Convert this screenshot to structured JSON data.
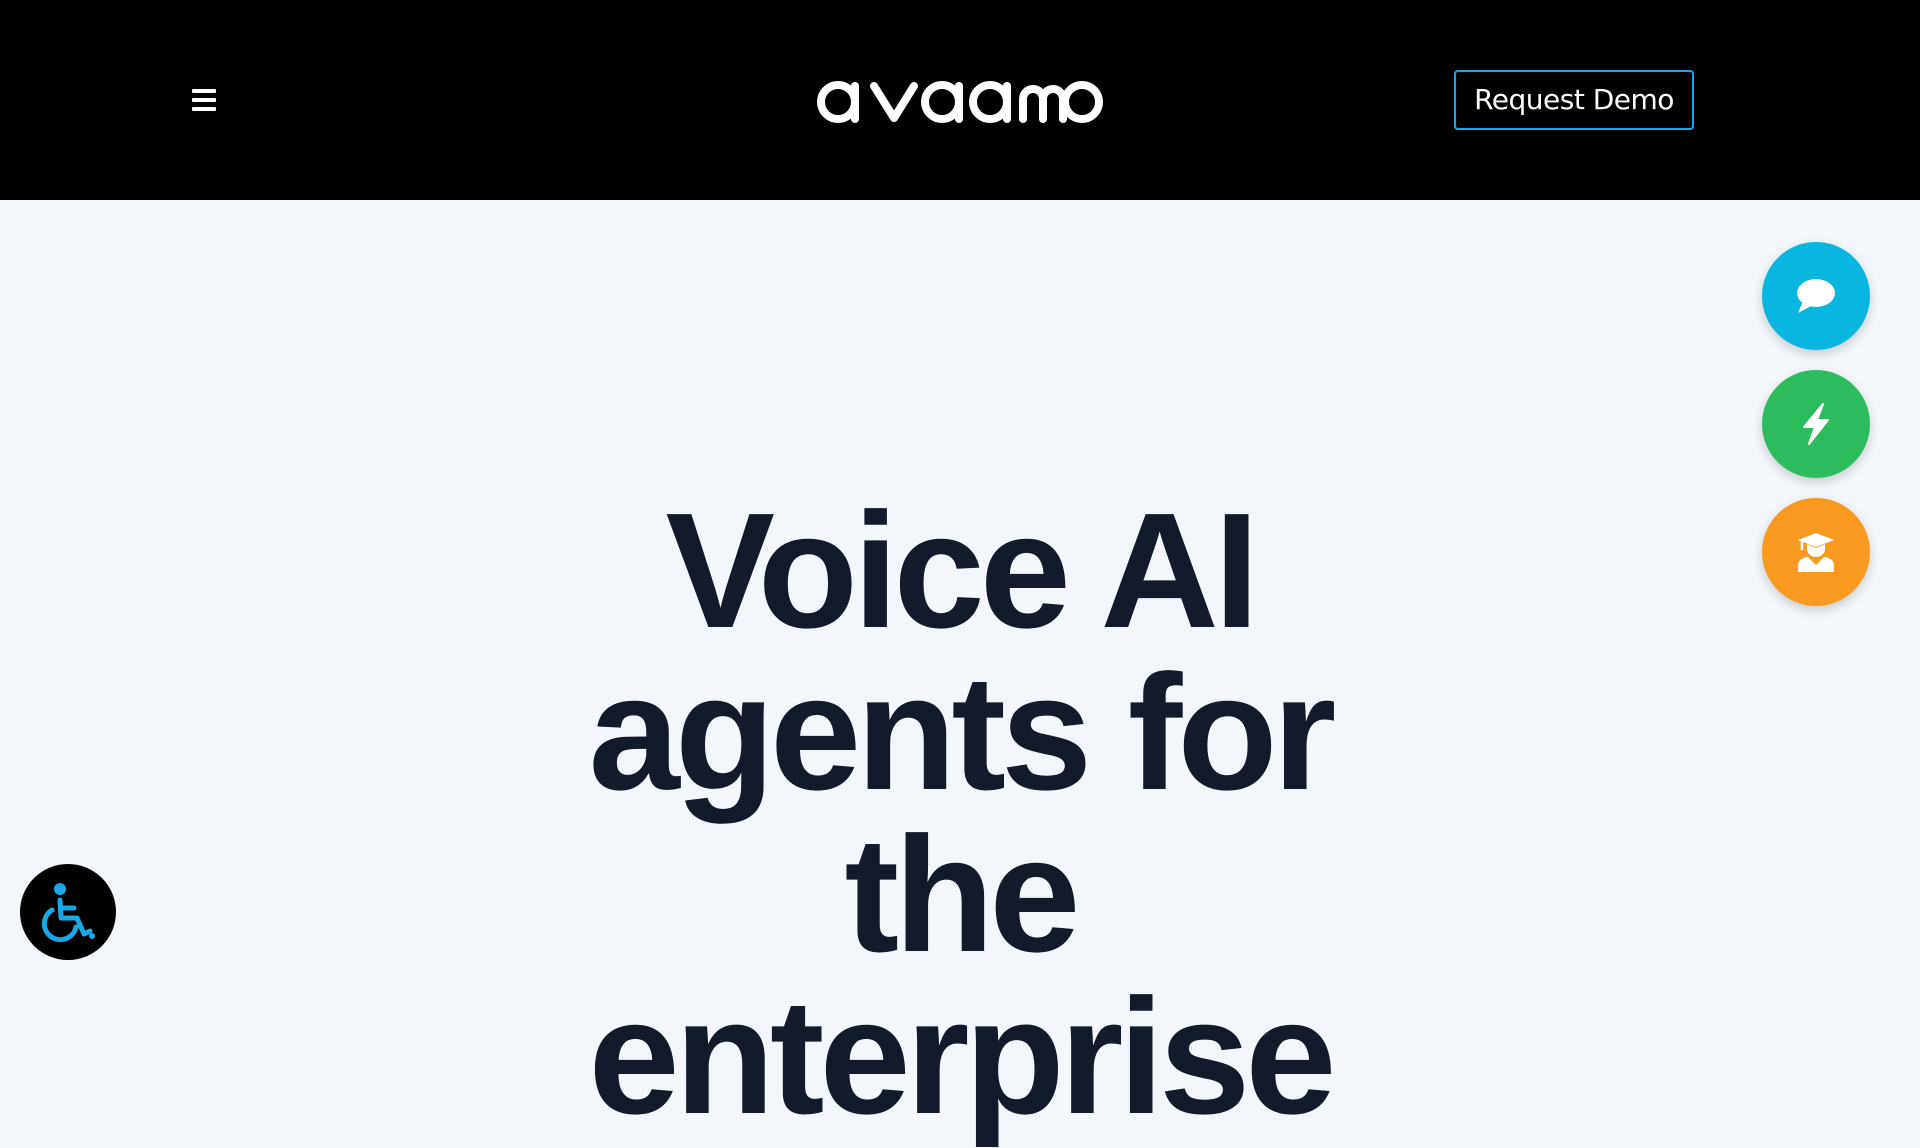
{
  "header": {
    "brand": "avaamo",
    "menu_icon": "hamburger-menu-icon",
    "request_demo_label": "Request Demo",
    "accent_color": "#1aa7e8"
  },
  "hero": {
    "title": "Voice AI agents for the enterprise"
  },
  "floating_actions": [
    {
      "icon": "chat-bubble-icon",
      "color": "#08b6e0"
    },
    {
      "icon": "lightning-bolt-icon",
      "color": "#2dbb5d"
    },
    {
      "icon": "graduate-icon",
      "color": "#f89a1f"
    }
  ],
  "accessibility": {
    "icon": "wheelchair-accessibility-icon",
    "icon_color": "#1aa7e8"
  }
}
